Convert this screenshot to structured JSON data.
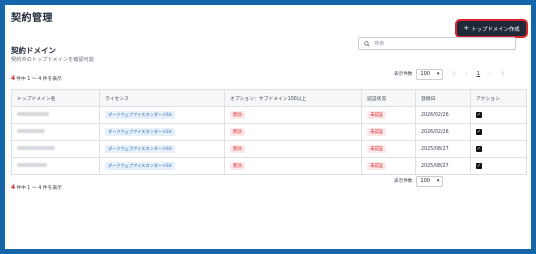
{
  "page": {
    "title": "契約管理"
  },
  "header": {
    "create_button": "トップドメイン作成",
    "plus": "+"
  },
  "section": {
    "title": "契約ドメイン",
    "subtitle": "契約中のトップドメインを確認可能"
  },
  "search": {
    "placeholder": "検索",
    "icon": "search-icon"
  },
  "count": {
    "num": "4",
    "text": "件中 1 〜 4 件を表示"
  },
  "pager": {
    "per_page_label": "表示件数",
    "per_page_value": "100",
    "arrow": "▾",
    "first": "|‹",
    "prev": "‹",
    "current": "1",
    "next": "›",
    "last": "›|"
  },
  "table": {
    "columns": [
      "トップドメイン名",
      "ライセンス",
      "オプション：サブドメイン100以上",
      "認証状況",
      "登録日",
      "アクション"
    ],
    "rows": [
      {
        "license": "ダークウェブアイスタンダードEd",
        "option": "無効",
        "status": "未認証",
        "date": "2026/02/26"
      },
      {
        "license": "ダークウェブアイスタンダードEd",
        "option": "無効",
        "status": "未認証",
        "date": "2026/02/26"
      },
      {
        "license": "ダークウェブアイスタンダードEd",
        "option": "無効",
        "status": "未認証",
        "date": "2025/08/27"
      },
      {
        "license": "ダークウェブアイスタンダードEd",
        "option": "無効",
        "status": "未認証",
        "date": "2025/08/27"
      }
    ]
  },
  "colors": {
    "frame": "#1466a8",
    "accent_red": "#d9232e",
    "button_dark": "#1f2937"
  }
}
